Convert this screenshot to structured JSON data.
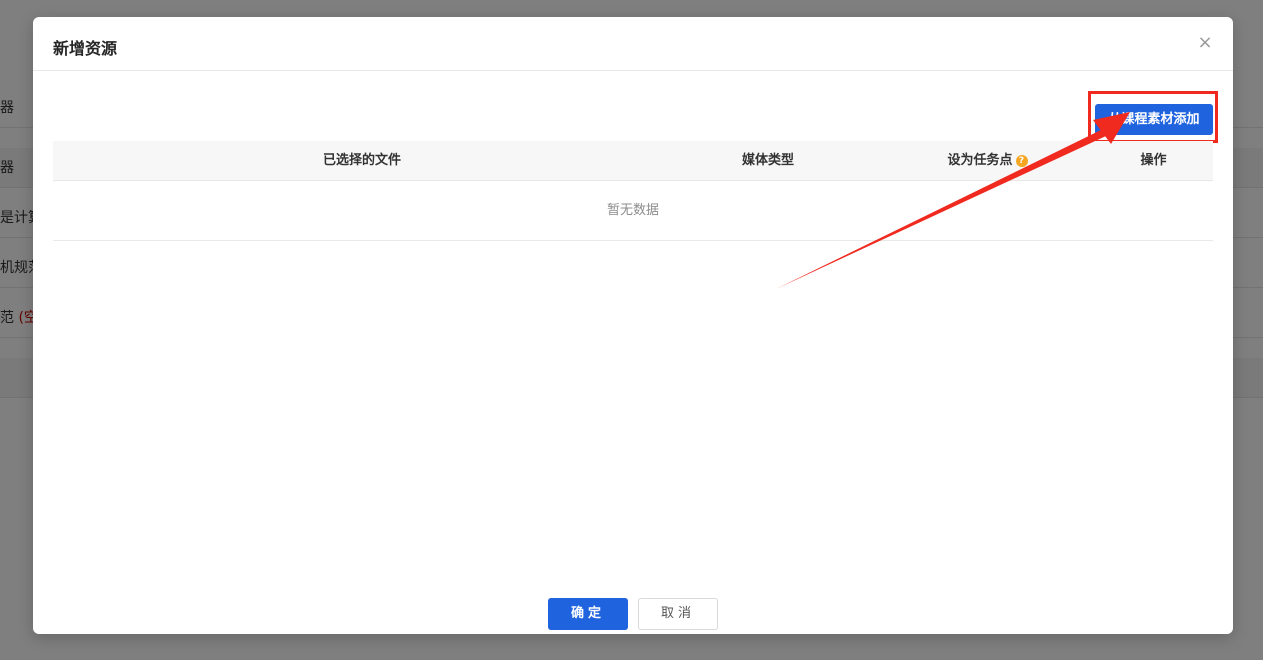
{
  "background": {
    "rows": [
      {
        "text": "器"
      },
      {
        "text": "器"
      },
      {
        "text": "是计算"
      },
      {
        "text": "机规范"
      },
      {
        "text": "范 ",
        "red": "(空"
      }
    ]
  },
  "modal": {
    "title": "新增资源",
    "close_glyph": "×",
    "add_button_label": "从课程素材添加",
    "table": {
      "columns": [
        "已选择的文件",
        "媒体类型",
        "设为任务点",
        "操作"
      ],
      "help_glyph": "?",
      "empty_text": "暂无数据"
    },
    "confirm_label": "确定",
    "cancel_label": "取消"
  },
  "colors": {
    "primary": "#1f63de",
    "annotation": "#f02a1f"
  }
}
